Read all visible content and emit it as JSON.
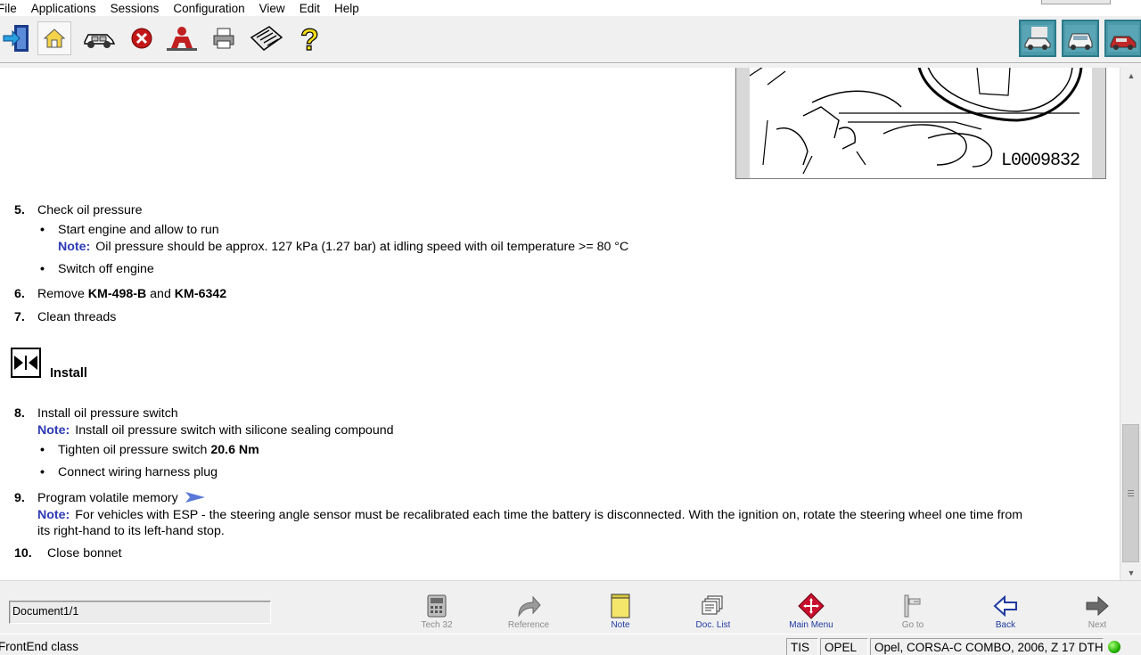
{
  "menu": {
    "items": [
      "File",
      "Applications",
      "Sessions",
      "Configuration",
      "View",
      "Edit",
      "Help"
    ]
  },
  "toolbar": {
    "left_icons": [
      "exit-icon",
      "home-icon",
      "vehicle-icon",
      "stop-icon",
      "user-icon",
      "print-icon",
      "keyboard-icon",
      "help-icon"
    ],
    "right_icons": [
      "car-service-icon",
      "car-front-icon",
      "car-red-icon"
    ]
  },
  "illustration": {
    "code": "L0009832"
  },
  "document": {
    "step5": {
      "num": "5.",
      "text": "Check oil pressure"
    },
    "step5_b1": "Start engine and allow to run",
    "step5_note_label": "Note:",
    "step5_note_text": "Oil pressure should be approx. 127 kPa (1.27 bar) at idling speed with oil temperature >= 80 °C",
    "step5_b2": "Switch off engine",
    "step6": {
      "num": "6.",
      "pre": "Remove ",
      "tool1": "KM-498-B",
      "mid": " and ",
      "tool2": "KM-6342"
    },
    "step7": {
      "num": "7.",
      "text": "Clean threads"
    },
    "install_heading": "Install",
    "step8": {
      "num": "8.",
      "text": "Install oil pressure switch"
    },
    "step8_note_label": "Note:",
    "step8_note_text": "Install oil pressure switch with silicone sealing compound",
    "step8_b1_pre": "Tighten oil pressure switch ",
    "step8_b1_torque": "20.6 Nm",
    "step8_b2": "Connect wiring harness plug",
    "step9": {
      "num": "9.",
      "text": "Program volatile memory"
    },
    "step9_note_label": "Note:",
    "step9_note_line1": "For vehicles with ESP - the steering angle sensor must be recalibrated each time the battery is disconnected. With the ignition on, rotate the steering wheel one time from",
    "step9_note_line2": "its right-hand to its left-hand stop.",
    "step10": {
      "num": "10.",
      "text": "Close bonnet"
    }
  },
  "navbar": {
    "doc_field": "Document1/1",
    "buttons": [
      {
        "label": "Tech 32",
        "icon": "tech32-icon",
        "enabled": false
      },
      {
        "label": "Reference",
        "icon": "reference-icon",
        "enabled": false
      },
      {
        "label": "Note",
        "icon": "note-icon",
        "enabled": true
      },
      {
        "label": "Doc. List",
        "icon": "doc-list-icon",
        "enabled": true
      },
      {
        "label": "Main Menu",
        "icon": "main-menu-icon",
        "enabled": true
      },
      {
        "label": "Go to",
        "icon": "goto-icon",
        "enabled": false
      },
      {
        "label": "Back",
        "icon": "back-icon",
        "enabled": true
      },
      {
        "label": "Next",
        "icon": "next-icon",
        "enabled": false
      }
    ]
  },
  "status": {
    "left": "FrontEnd class",
    "system": "TIS",
    "brand": "OPEL",
    "vehicle": "Opel, CORSA-C COMBO, 2006, Z 17 DTH",
    "colors": {
      "led": "#22b000",
      "note_label": "#2d3ab4",
      "main_menu": "#c8102e"
    }
  }
}
